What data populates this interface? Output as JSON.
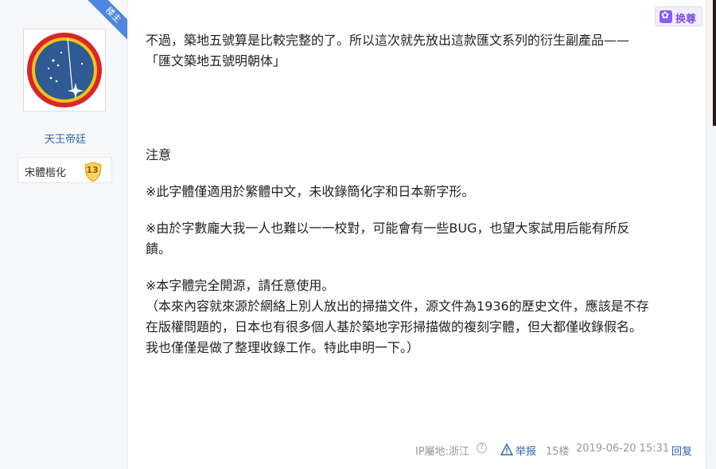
{
  "user": {
    "name": "天王帝廷",
    "level_name": "宋體楷化",
    "level_number": "13",
    "role_badge": "楼主"
  },
  "toolbar": {
    "swap_label": "换尊",
    "swap_icon": "paw-icon"
  },
  "post": {
    "line1": "不過，築地五號算是比較完整的了。所以這次就先放出這款匯文系列的衍生副產品——",
    "line2": "「匯文築地五號明朝体」",
    "notice_title": "注意",
    "note1": "※此字體僅適用於繁體中文，未收錄簡化字和日本新字形。",
    "note2a": "※由於字數龐大我一人也難以一一校對，可能會有一些BUG，也望大家試用后能有所反",
    "note2b": "饋。",
    "note3": "※本字體完全開源，請任意使用。",
    "note4a": "（本來內容就來源於網絡上別人放出的掃描文件，源文件為1936的歷史文件，應該是不存",
    "note4b": "在版權問題的，日本也有很多個人基於築地字形掃描做的複刻字體，但大都僅收錄假名。",
    "note4c": "我也僅僅是做了整理收錄工作。特此申明一下。）"
  },
  "footer": {
    "ip_location": "IP屬地:浙江",
    "help_icon": "?",
    "report_label": "举报",
    "floor": "15楼",
    "timestamp": "2019-06-20 15:31",
    "reply_label": "回复"
  },
  "colors": {
    "link": "#2d64b3",
    "ribbon": "#4e86e0",
    "swap_accent": "#8b5cf6"
  }
}
